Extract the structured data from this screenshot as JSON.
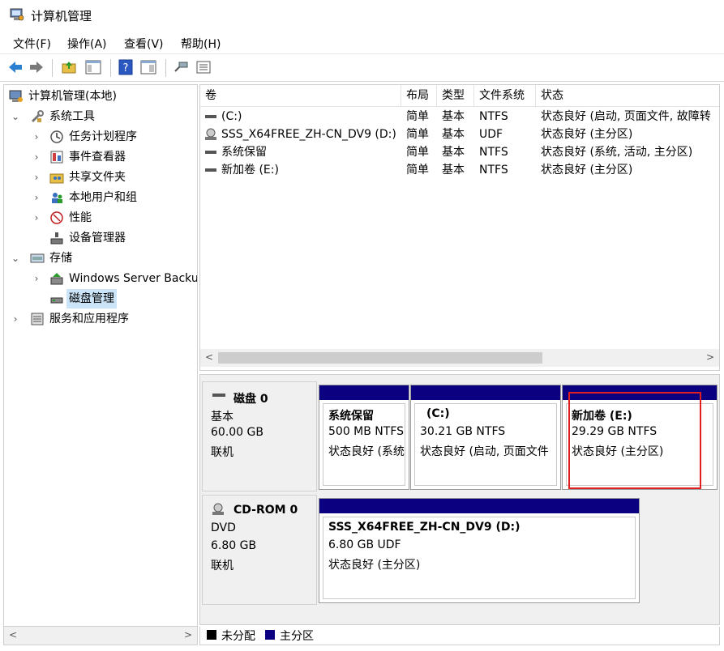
{
  "window": {
    "title": "计算机管理"
  },
  "menu": [
    "文件(F)",
    "操作(A)",
    "查看(V)",
    "帮助(H)"
  ],
  "toolbar": [
    "back-icon",
    "forward-icon",
    "up-folder-icon",
    "show-tree-icon",
    "help-icon",
    "properties-icon",
    "connect-icon",
    "list-view-icon"
  ],
  "tree": {
    "root": "计算机管理(本地)",
    "system_tools": "系统工具",
    "task_scheduler": "任务计划程序",
    "event_viewer": "事件查看器",
    "shared_folders": "共享文件夹",
    "local_users": "本地用户和组",
    "performance": "性能",
    "device_manager": "设备管理器",
    "storage": "存储",
    "windows_backup": "Windows Server Backup",
    "disk_management": "磁盘管理",
    "services": "服务和应用程序"
  },
  "columns": [
    "卷",
    "布局",
    "类型",
    "文件系统",
    "状态"
  ],
  "volumes": [
    {
      "name": "(C:)",
      "layout": "简单",
      "type": "基本",
      "fs": "NTFS",
      "status": "状态良好 (启动, 页面文件, 故障转"
    },
    {
      "name": "SSS_X64FREE_ZH-CN_DV9 (D:)",
      "layout": "简单",
      "type": "基本",
      "fs": "UDF",
      "status": "状态良好 (主分区)"
    },
    {
      "name": "系统保留",
      "layout": "简单",
      "type": "基本",
      "fs": "NTFS",
      "status": "状态良好 (系统, 活动, 主分区)"
    },
    {
      "name": "新加卷 (E:)",
      "layout": "简单",
      "type": "基本",
      "fs": "NTFS",
      "status": "状态良好 (主分区)"
    }
  ],
  "disks": [
    {
      "title": "磁盘 0",
      "kind": "基本",
      "size": "60.00 GB",
      "state": "联机",
      "partitions": [
        {
          "name": "系统保留",
          "size": "500 MB NTFS",
          "status": "状态良好 (系统"
        },
        {
          "name": "(C:)",
          "size": "30.21 GB NTFS",
          "status": "状态良好 (启动, 页面文件"
        },
        {
          "name": "新加卷  (E:)",
          "size": "29.29 GB NTFS",
          "status": "状态良好 (主分区)"
        }
      ]
    },
    {
      "title": "CD-ROM 0",
      "kind": "DVD",
      "size": "6.80 GB",
      "state": "联机",
      "partitions": [
        {
          "name": "SSS_X64FREE_ZH-CN_DV9  (D:)",
          "size": "6.80 GB UDF",
          "status": "状态良好 (主分区)"
        }
      ]
    }
  ],
  "legend": {
    "unallocated": "未分配",
    "primary": "主分区"
  },
  "colors": {
    "primary_partition": "#0a0080",
    "unallocated": "#000000",
    "selection": "#cce4f7",
    "highlight_box": "#e02020"
  }
}
